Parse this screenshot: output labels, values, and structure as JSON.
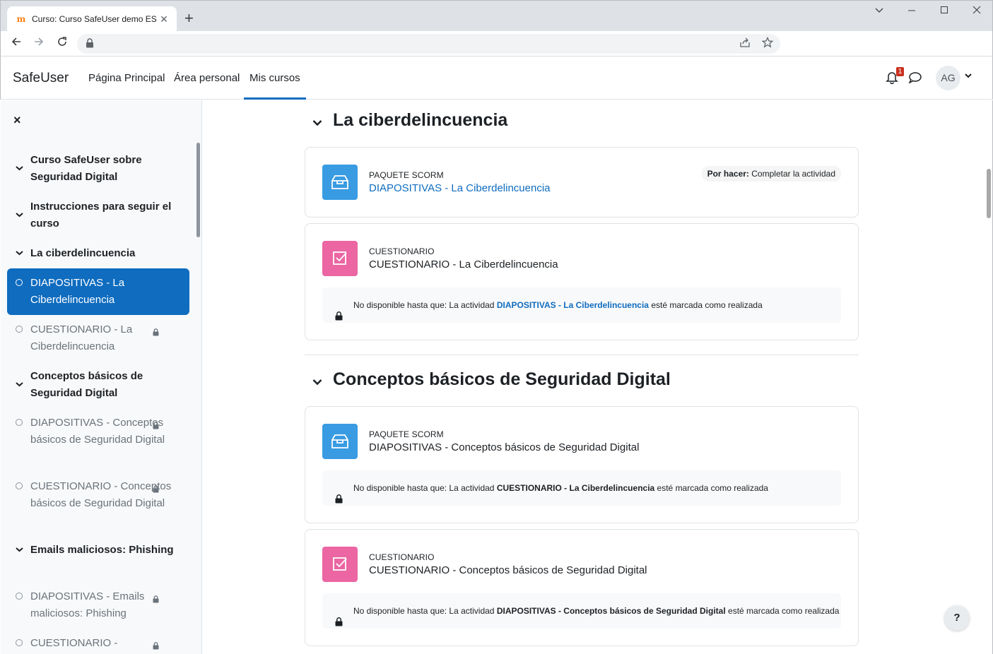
{
  "browser": {
    "tab_title": "Curso: Curso SafeUser demo ES",
    "tab_favicon": "moodle-favicon",
    "new_tab": "+",
    "close_tab": "✕"
  },
  "navbar": {
    "brand": "SafeUser",
    "links": [
      "Página Principal",
      "Área personal",
      "Mis cursos"
    ],
    "active_link": "Mis cursos",
    "notification_count": "1",
    "avatar_initials": "AG",
    "accent": "#0f6cbf"
  },
  "drawer": {
    "close": "×",
    "items": [
      {
        "type": "section",
        "label": "Curso SafeUser sobre Seguridad Digital"
      },
      {
        "type": "section",
        "label": "Instrucciones para seguir el curso"
      },
      {
        "type": "section",
        "label": "La ciberdelincuencia"
      },
      {
        "type": "activity",
        "label": "DIAPOSITIVAS - La Ciberdelincuencia",
        "current": true,
        "locked": false
      },
      {
        "type": "activity",
        "label": "CUESTIONARIO - La Ciberdelincuencia",
        "locked": true
      },
      {
        "type": "section",
        "label": "Conceptos básicos de Seguridad Digital"
      },
      {
        "type": "activity",
        "label": "DIAPOSITIVAS - Conceptos básicos de Seguridad Digital",
        "locked": true
      },
      {
        "type": "activity",
        "label": "CUESTIONARIO - Conceptos básicos de Seguridad Digital",
        "locked": true
      },
      {
        "type": "section",
        "label": "Emails maliciosos: Phishing"
      },
      {
        "type": "activity",
        "label": "DIAPOSITIVAS - Emails maliciosos: Phishing",
        "locked": true
      },
      {
        "type": "activity",
        "label": "CUESTIONARIO -",
        "locked": true
      }
    ]
  },
  "sections": [
    {
      "title": "La ciberdelincuencia",
      "activities": [
        {
          "icon": "scorm-package-icon",
          "type": "PAQUETE SCORM",
          "name": "DIAPOSITIVAS - La Ciberdelincuencia",
          "is_link": true,
          "todo_label": "Por hacer:",
          "todo_text": "Completar la actividad"
        },
        {
          "icon": "quiz-icon",
          "type": "CUESTIONARIO",
          "name": "CUESTIONARIO - La Ciberdelincuencia",
          "restriction_prefix": "No disponible hasta que: La actividad",
          "restriction_activity": "DIAPOSITIVAS - La Ciberdelincuencia",
          "restriction_suffix": "esté marcada como realizada",
          "restriction_is_link": true
        }
      ]
    },
    {
      "title": "Conceptos básicos de Seguridad Digital",
      "activities": [
        {
          "icon": "scorm-package-icon",
          "type": "PAQUETE SCORM",
          "name": "DIAPOSITIVAS - Conceptos básicos de Seguridad Digital",
          "restriction_prefix": "No disponible hasta que: La actividad",
          "restriction_activity": "CUESTIONARIO - La Ciberdelincuencia",
          "restriction_suffix": "esté marcada como realizada"
        },
        {
          "icon": "quiz-icon",
          "type": "CUESTIONARIO",
          "name": "CUESTIONARIO - Conceptos básicos de Seguridad Digital",
          "restriction_prefix": "No disponible hasta que: La actividad",
          "restriction_activity": "DIAPOSITIVAS - Conceptos básicos de Seguridad Digital",
          "restriction_suffix": "esté marcada como realizada"
        }
      ]
    }
  ],
  "help": "?",
  "colors": {
    "scorm": "#399be2",
    "quiz": "#eb66a2",
    "current_item_bg": "#0f6cbf"
  }
}
